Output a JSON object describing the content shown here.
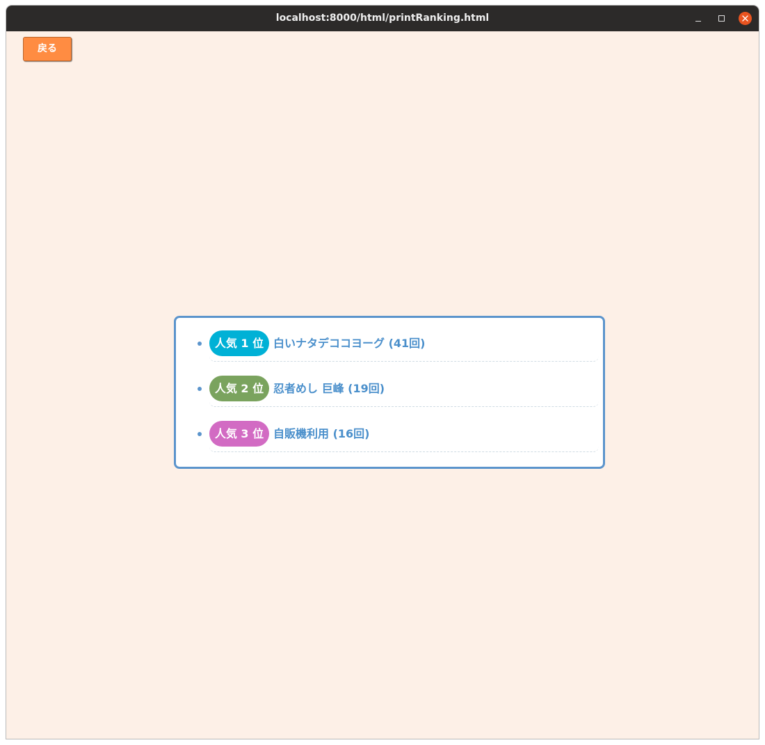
{
  "window": {
    "title": "localhost:8000/html/printRanking.html"
  },
  "toolbar": {
    "back_label": "戻る"
  },
  "ranking": {
    "items": [
      {
        "badge": "人気 1 位",
        "label": "白いナタデココヨーグ (41回)",
        "badge_color": "#00b1d6"
      },
      {
        "badge": "人気 2 位",
        "label": "忍者めし 巨峰 (19回)",
        "badge_color": "#7aa35e"
      },
      {
        "badge": "人気 3 位",
        "label": "自販機利用 (16回)",
        "badge_color": "#d26bc3"
      }
    ]
  },
  "colors": {
    "background": "#fdf0e7",
    "accent": "#5b94cc",
    "back_button": "#ff8c42",
    "titlebar": "#2c2a29",
    "close_button": "#e95420"
  }
}
